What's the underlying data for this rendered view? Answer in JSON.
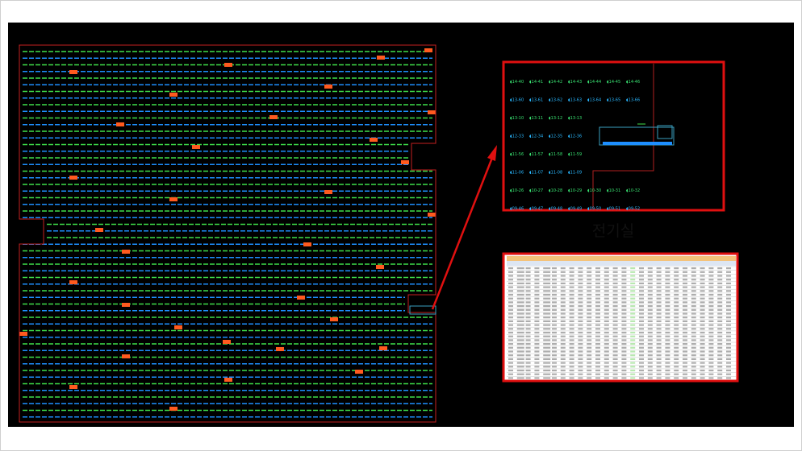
{
  "caption": "전기실",
  "colors": {
    "background": "#000000",
    "outline": "#d02020",
    "row_green": "#3fe04a",
    "row_blue": "#1e8fff",
    "inverter": "#ff5a1f",
    "highlight_box": "#e01010",
    "arrow": "#e01010",
    "label_cyan": "#2ab8ff",
    "label_green": "#38e070"
  },
  "electrical_room_labels": [
    [
      "14-40",
      "14-41",
      "14-42",
      "14-43",
      "14-44",
      "14-45",
      "14-46"
    ],
    [
      "13-60",
      "13-61",
      "13-62",
      "13-63",
      "13-64",
      "13-65",
      "13-66"
    ],
    [
      "13-10",
      "13-11",
      "13-12",
      "13-13"
    ],
    [
      "12-33",
      "12-34",
      "12-35",
      "12-36"
    ],
    [
      "11-56",
      "11-57",
      "11-58",
      "11-59"
    ],
    [
      "11-06",
      "11-07",
      "11-08",
      "11-09"
    ],
    [
      "10-26",
      "10-27",
      "10-28",
      "10-29",
      "10-30",
      "10-31",
      "10-32"
    ],
    [
      "09-46",
      "09-47",
      "09-48",
      "09-49",
      "09-50",
      "09-51",
      "09-52"
    ]
  ],
  "table_header_top": [
    "",
    "",
    "",
    "",
    "",
    "",
    "",
    "",
    "",
    "",
    "",
    ""
  ],
  "table_rows": 30
}
